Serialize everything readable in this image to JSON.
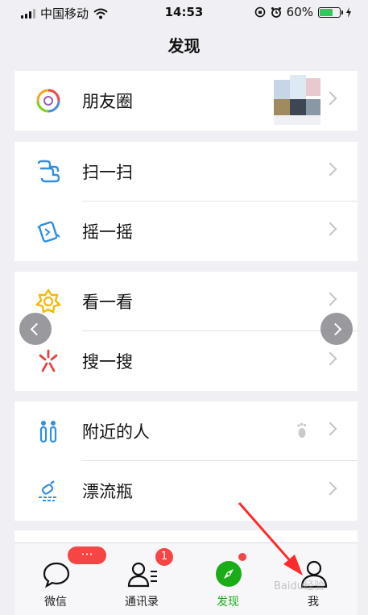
{
  "status_bar": {
    "carrier": "中国移动",
    "time": "14:53",
    "battery_percent": "60%"
  },
  "title": "发现",
  "groups": [
    {
      "items": [
        {
          "label": "朋友圈",
          "icon": "moments-icon"
        }
      ]
    },
    {
      "items": [
        {
          "label": "扫一扫",
          "icon": "scan-icon"
        },
        {
          "label": "摇一摇",
          "icon": "shake-icon"
        }
      ]
    },
    {
      "items": [
        {
          "label": "看一看",
          "icon": "top-stories-icon"
        },
        {
          "label": "搜一搜",
          "icon": "search-icon"
        }
      ]
    },
    {
      "items": [
        {
          "label": "附近的人",
          "icon": "people-nearby-icon"
        },
        {
          "label": "漂流瓶",
          "icon": "drift-bottle-icon"
        }
      ]
    }
  ],
  "tabs": [
    {
      "label": "微信",
      "icon": "chat-bubble-icon",
      "badge": "···"
    },
    {
      "label": "通讯录",
      "icon": "contacts-icon",
      "badge": "1"
    },
    {
      "label": "发现",
      "icon": "compass-icon",
      "active": true
    },
    {
      "label": "我",
      "icon": "person-icon"
    }
  ],
  "watermark": "Baidu经验",
  "colors": {
    "accent_green": "#1aad19",
    "badge_red": "#f54545",
    "background": "#efeff4"
  }
}
